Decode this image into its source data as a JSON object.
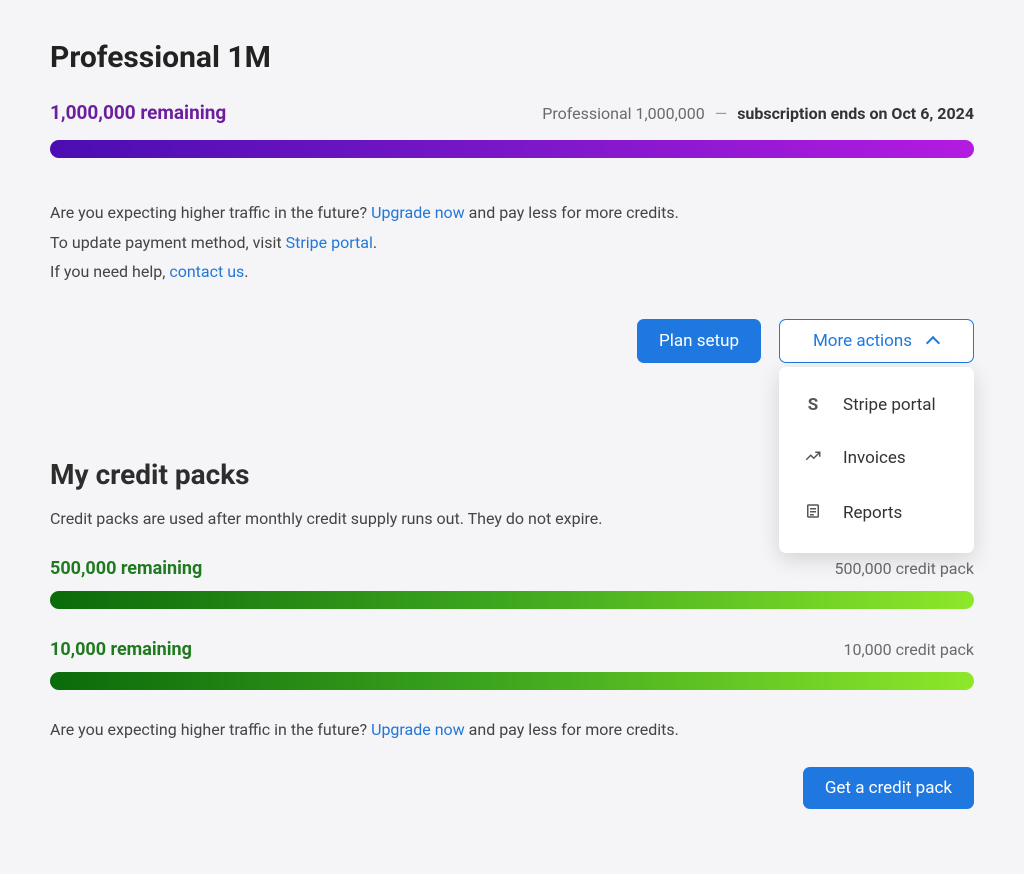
{
  "plan": {
    "title": "Professional 1M",
    "remaining": "1,000,000 remaining",
    "right_plan": "Professional 1,000,000",
    "ends": "subscription ends on Oct 6, 2024"
  },
  "info": {
    "l1_pre": "Are you expecting higher traffic in the future? ",
    "l1_link": "Upgrade now",
    "l1_post": " and pay less for more credits.",
    "l2_pre": "To update payment method, visit ",
    "l2_link": "Stripe portal",
    "l2_post": ".",
    "l3_pre": "If you need help, ",
    "l3_link": "contact us",
    "l3_post": "."
  },
  "buttons": {
    "plan_setup": "Plan setup",
    "more_actions": "More actions",
    "get_credit_pack": "Get a credit pack"
  },
  "dropdown": {
    "stripe": "Stripe portal",
    "invoices": "Invoices",
    "reports": "Reports"
  },
  "packs": {
    "title": "My credit packs",
    "description": "Credit packs are used after monthly credit supply runs out. They do not expire.",
    "items": [
      {
        "remaining": "500,000 remaining",
        "name": "500,000 credit pack"
      },
      {
        "remaining": "10,000 remaining",
        "name": "10,000 credit pack"
      }
    ],
    "footer_pre": "Are you expecting higher traffic in the future? ",
    "footer_link": "Upgrade now",
    "footer_post": " and pay less for more credits."
  }
}
